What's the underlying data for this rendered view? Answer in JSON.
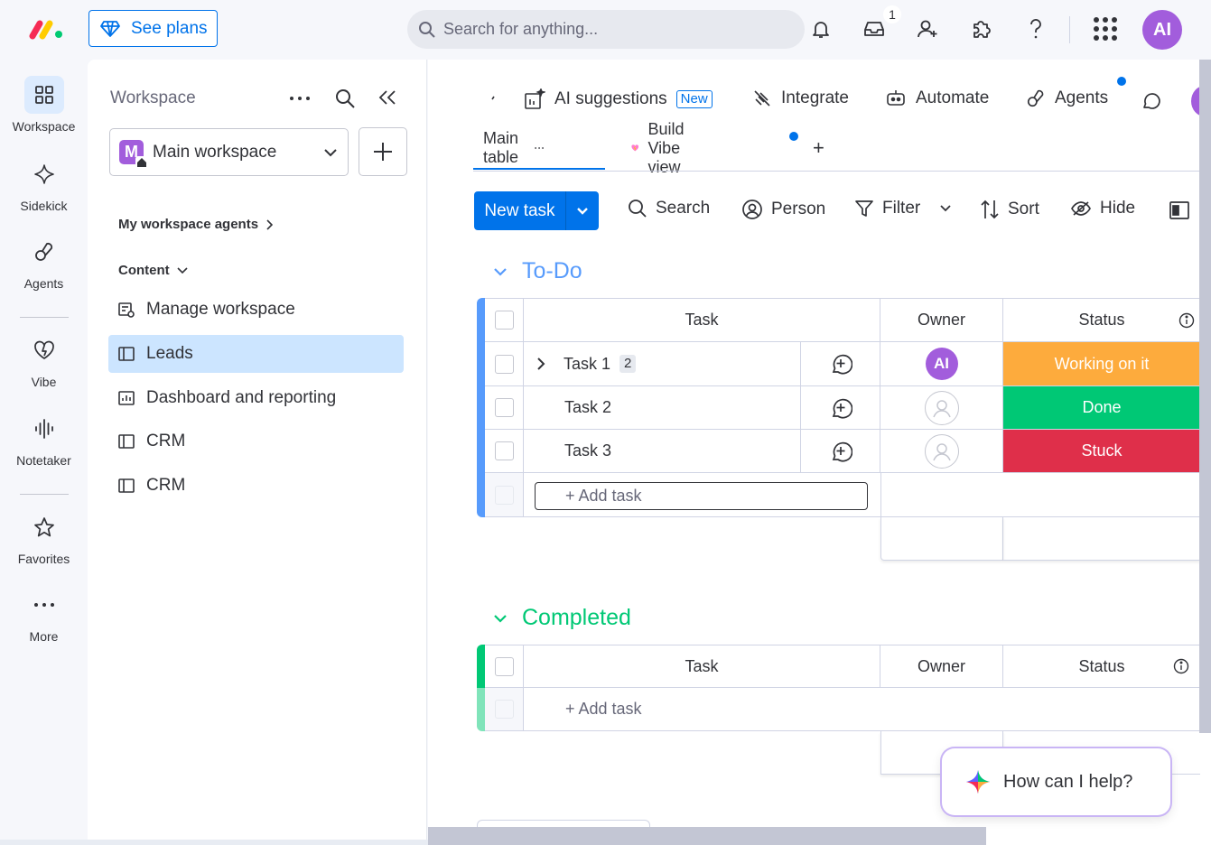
{
  "topbar": {
    "see_plans": "See plans",
    "search_placeholder": "Search for anything...",
    "inbox_count": "1",
    "avatar": "AI"
  },
  "rail": {
    "items": [
      {
        "label": "Workspace",
        "icon": "grid-icon"
      },
      {
        "label": "Sidekick",
        "icon": "sparkle-icon"
      },
      {
        "label": "Agents",
        "icon": "agents-icon"
      },
      {
        "label": "Vibe",
        "icon": "heart-icon"
      },
      {
        "label": "Notetaker",
        "icon": "waveform-icon"
      },
      {
        "label": "Favorites",
        "icon": "star-icon"
      },
      {
        "label": "More",
        "icon": "more-dots-icon"
      }
    ]
  },
  "panel": {
    "title": "Workspace",
    "workspace_name": "Main workspace",
    "workspace_initial": "M",
    "agents_section": "My workspace agents",
    "content_section": "Content",
    "items": [
      {
        "label": "Manage workspace",
        "icon": "manage-icon"
      },
      {
        "label": "Leads",
        "icon": "board-icon"
      },
      {
        "label": "Dashboard and reporting",
        "icon": "dashboard-icon"
      },
      {
        "label": "CRM",
        "icon": "board-icon"
      },
      {
        "label": "CRM",
        "icon": "board-icon"
      }
    ]
  },
  "main": {
    "toolbar": {
      "ai_suggestions": "AI suggestions",
      "new_tag": "New",
      "integrate": "Integrate",
      "automate": "Automate",
      "agents": "Agents"
    },
    "tabs": {
      "main_table": "Main table",
      "build_vibe": "Build Vibe view",
      "add": "+"
    },
    "actions": {
      "new_task": "New task",
      "search": "Search",
      "person": "Person",
      "filter": "Filter",
      "sort": "Sort",
      "hide": "Hide"
    },
    "groups": [
      {
        "title": "To-Do",
        "color": "#579bfc",
        "columns": {
          "task": "Task",
          "owner": "Owner",
          "status": "Status"
        },
        "rows": [
          {
            "task": "Task 1",
            "subitems": "2",
            "owner": "AI",
            "status": "Working on it",
            "status_color": "#fdab3d"
          },
          {
            "task": "Task 2",
            "owner": "",
            "status": "Done",
            "status_color": "#00c875"
          },
          {
            "task": "Task 3",
            "owner": "",
            "status": "Stuck",
            "status_color": "#df2f4a"
          }
        ],
        "add_task": "+ Add task"
      },
      {
        "title": "Completed",
        "color": "#00c875",
        "columns": {
          "task": "Task",
          "owner": "Owner",
          "status": "Status"
        },
        "add_task": "+ Add task"
      }
    ],
    "help": "How can I help?"
  }
}
